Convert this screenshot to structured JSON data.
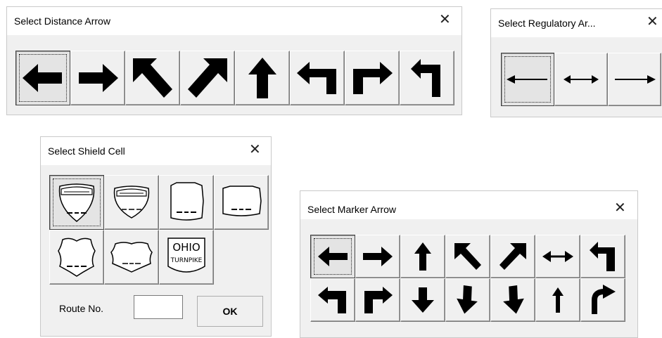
{
  "distance_dialog": {
    "title": "Select Distance Arrow",
    "close_glyph": "✕",
    "arrows": [
      "arrow-left-icon",
      "arrow-right-icon",
      "arrow-up-left-icon",
      "arrow-up-right-icon",
      "arrow-up-icon",
      "arrow-turn-left-icon",
      "arrow-turn-right-icon",
      "arrow-u-turn-icon"
    ]
  },
  "regulatory_dialog": {
    "title": "Select Regulatory Ar...",
    "close_glyph": "✕",
    "arrows": [
      "line-arrow-left-icon",
      "line-arrow-both-icon",
      "line-arrow-right-icon"
    ]
  },
  "shield_dialog": {
    "title": "Select Shield Cell",
    "close_glyph": "✕",
    "shields": [
      "interstate-shield-icon",
      "interstate-wide-shield-icon",
      "state-shield-icon",
      "state-wide-shield-icon",
      "us-route-shield-icon",
      "us-route-wide-shield-icon",
      "ohio-turnpike-shield-icon"
    ],
    "turnpike_text_1": "OHIO",
    "turnpike_text_2": "TURNPIKE",
    "route_label": "Route No.",
    "route_value": "",
    "ok_label": "OK"
  },
  "marker_dialog": {
    "title": "Select Marker Arrow",
    "close_glyph": "✕",
    "row1": [
      "arrow-left-icon",
      "arrow-right-icon",
      "arrow-up-icon",
      "arrow-up-left-icon",
      "arrow-up-right-icon",
      "arrow-left-right-icon",
      "arrow-turn-left-icon"
    ],
    "row2": [
      "arrow-turn-left-down-icon",
      "arrow-turn-right-icon",
      "arrow-down-icon",
      "arrow-down-left-icon",
      "arrow-down-right-icon",
      "arrow-up-thin-icon",
      "arrow-curve-right-icon"
    ]
  }
}
